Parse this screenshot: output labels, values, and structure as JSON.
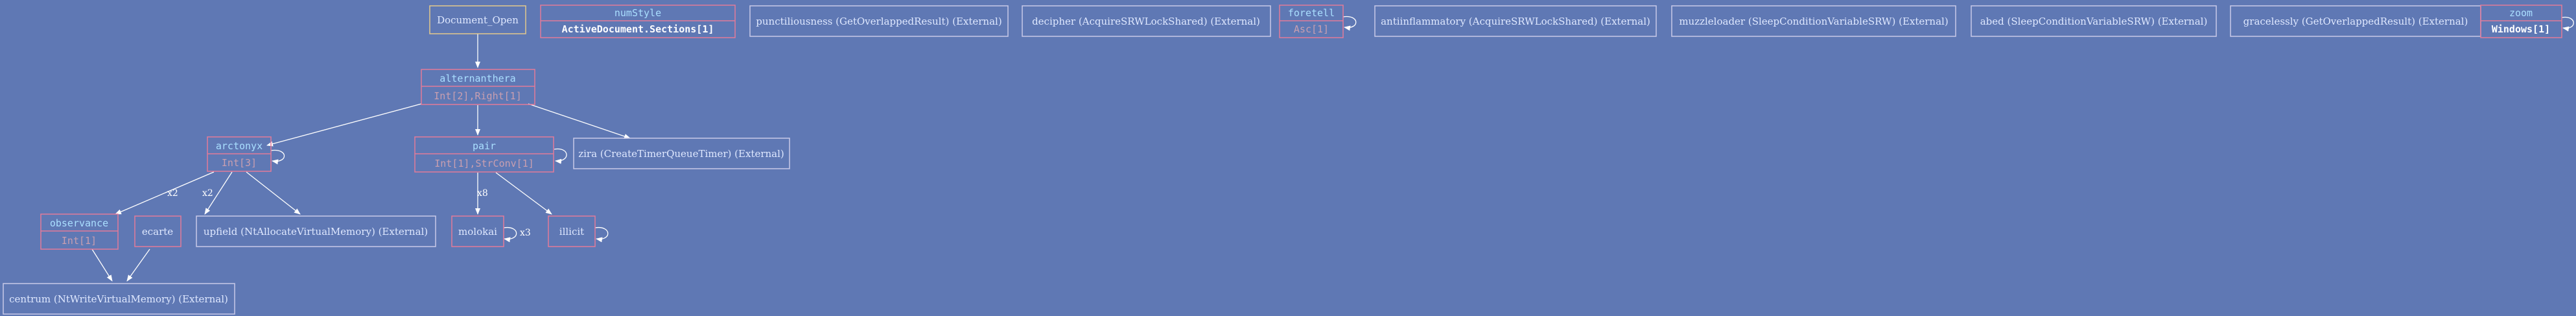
{
  "nodes": {
    "document_open": {
      "label": "Document_Open"
    },
    "numstyle": {
      "title": "numStyle",
      "detail": "ActiveDocument.Sections[1]"
    },
    "punctiliousness": {
      "label": "punctiliousness (GetOverlappedResult) (External)"
    },
    "decipher": {
      "label": "decipher (AcquireSRWLockShared) (External)"
    },
    "foretell": {
      "title": "foretell",
      "detail": "Asc[1]"
    },
    "antiinflammatory": {
      "label": "antiinflammatory (AcquireSRWLockShared) (External)"
    },
    "muzzleloader": {
      "label": "muzzleloader (SleepConditionVariableSRW) (External)"
    },
    "abed": {
      "label": "abed (SleepConditionVariableSRW) (External)"
    },
    "gracelessly": {
      "label": "gracelessly (GetOverlappedResult) (External)"
    },
    "zoom": {
      "title": "zoom",
      "detail": "Windows[1]"
    },
    "alternanthera": {
      "title": "alternanthera",
      "detail": "Int[2],Right[1]"
    },
    "arctonyx": {
      "title": "arctonyx",
      "detail": "Int[3]"
    },
    "pair": {
      "title": "pair",
      "detail": "Int[1],StrConv[1]"
    },
    "zira": {
      "label": "zira (CreateTimerQueueTimer) (External)"
    },
    "observance": {
      "title": "observance",
      "detail": "Int[1]"
    },
    "ecarte": {
      "label": "ecarte"
    },
    "upfield": {
      "label": "upfield (NtAllocateVirtualMemory) (External)"
    },
    "molokai": {
      "label": "molokai"
    },
    "illicit": {
      "label": "illicit"
    },
    "centrum": {
      "label": "centrum (NtWriteVirtualMemory) (External)"
    }
  },
  "edge_labels": {
    "arctonyx_observance": "x2",
    "arctonyx_ecarte": "x2",
    "pair_molokai": "x8",
    "molokai_self": "x3"
  },
  "colors": {
    "background": "#5f78b4",
    "node_border": "#c9c9e8",
    "function_border": "#e27a9a",
    "edge": "#ffffff"
  }
}
